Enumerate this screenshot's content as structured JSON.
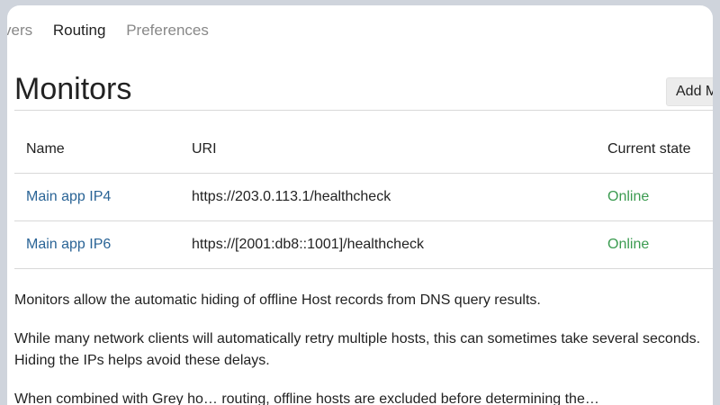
{
  "tabs": [
    {
      "label": "vers",
      "active": false
    },
    {
      "label": "Routing",
      "active": true
    },
    {
      "label": "Preferences",
      "active": false
    }
  ],
  "page": {
    "title": "Monitors",
    "add_button_label": "Add M"
  },
  "table": {
    "headers": {
      "name": "Name",
      "uri": "URI",
      "state": "Current state"
    },
    "rows": [
      {
        "name": "Main app IP4",
        "uri": "https://203.0.113.1/healthcheck",
        "state": "Online"
      },
      {
        "name": "Main app IP6",
        "uri": "https://[2001:db8::1001]/healthcheck",
        "state": "Online"
      }
    ]
  },
  "description": {
    "p1": "Monitors allow the automatic hiding of offline Host records from DNS query results.",
    "p2": "While many network clients will automatically retry multiple hosts, this can sometimes take several seconds. Hiding the IPs helps avoid these delays.",
    "p3": "When combined with Grey ho… routing, offline hosts are excluded before determining the…"
  },
  "colors": {
    "link": "#2a6496",
    "online": "#3b9b50",
    "background": "#cfd4dc"
  }
}
